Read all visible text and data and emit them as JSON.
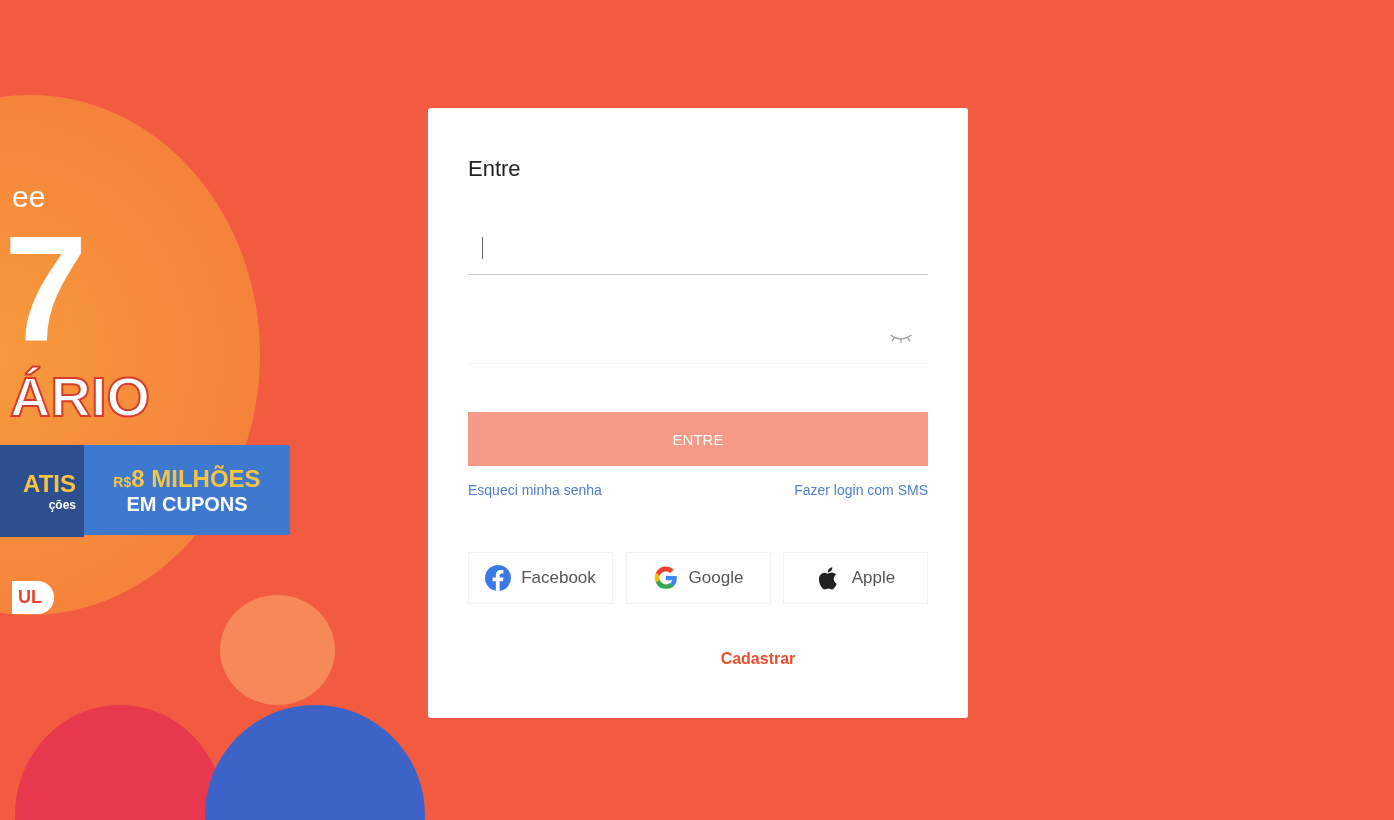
{
  "banner": {
    "brand": "ee",
    "number": "7",
    "headline": "ÁRIO",
    "ribbon_left": {
      "title": "ATIS",
      "subtitle": "ções"
    },
    "ribbon_right": {
      "currency": "R$",
      "amount": "8 MILHÕES",
      "subtitle": "EM CUPONS"
    },
    "pill": "UL"
  },
  "login": {
    "title": "Entre",
    "fields": [
      {
        "kind": "text",
        "focused": true
      },
      {
        "kind": "password",
        "focused": false
      }
    ],
    "submit": {
      "label": "ENTRE",
      "disabled": true
    },
    "links": [
      "Esqueci minha senha",
      "Fazer login com SMS"
    ],
    "social": [
      {
        "kind": "facebook",
        "label": "Facebook"
      },
      {
        "kind": "google",
        "label": "Google"
      },
      {
        "kind": "apple",
        "label": "Apple"
      }
    ],
    "signup": "Cadastrar"
  }
}
